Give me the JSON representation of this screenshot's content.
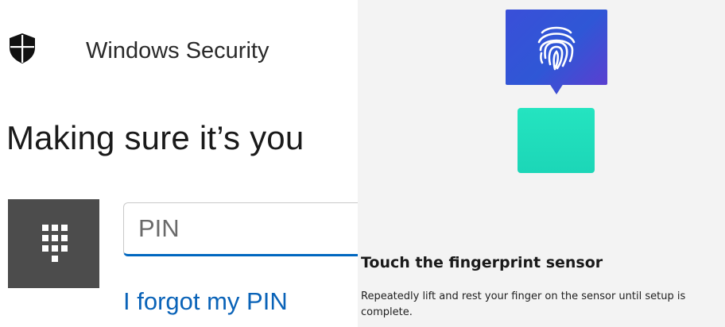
{
  "security_dialog": {
    "app_title": "Windows Security",
    "heading": "Making sure it’s you",
    "pin_field": {
      "placeholder": "PIN",
      "value": ""
    },
    "forgot_link": "I forgot my PIN",
    "icons": {
      "app": "shield-icon",
      "credential": "keypad-icon"
    }
  },
  "fingerprint_setup": {
    "heading": "Touch the fingerprint sensor",
    "body": "Repeatedly lift and rest your finger on the sensor until setup is complete.",
    "icons": {
      "bubble": "fingerprint-icon",
      "pad": "fingerprint-sensor"
    }
  },
  "colors": {
    "accent": "#0067c0",
    "link": "#0a63b8",
    "keypad_tile": "#4c4c4c",
    "fingerprint_bubble": "#3a4fd8",
    "sensor_pad": "#1fdcbb",
    "right_panel_bg": "#f3f3f3"
  }
}
